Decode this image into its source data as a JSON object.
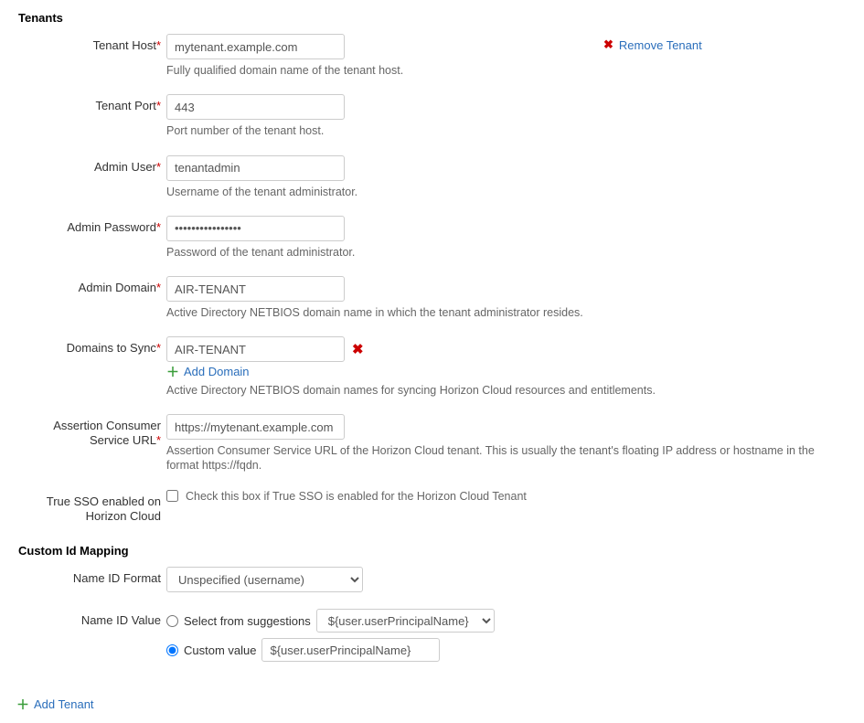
{
  "tenants": {
    "heading": "Tenants",
    "removeTenant": "Remove Tenant",
    "fields": {
      "tenantHost": {
        "label": "Tenant Host",
        "value": "mytenant.example.com",
        "helper": "Fully qualified domain name of the tenant host."
      },
      "tenantPort": {
        "label": "Tenant Port",
        "value": "443",
        "helper": "Port number of the tenant host."
      },
      "adminUser": {
        "label": "Admin User",
        "value": "tenantadmin",
        "helper": "Username of the tenant administrator."
      },
      "adminPassword": {
        "label": "Admin Password",
        "value": "••••••••••••••••",
        "helper": "Password of the tenant administrator."
      },
      "adminDomain": {
        "label": "Admin Domain",
        "value": "AIR-TENANT",
        "helper": "Active Directory NETBIOS domain name in which the tenant administrator resides."
      },
      "domainsToSync": {
        "label": "Domains to Sync",
        "value": "AIR-TENANT",
        "addDomain": "Add Domain",
        "helper": "Active Directory NETBIOS domain names for syncing Horizon Cloud resources and entitlements."
      },
      "acsUrl": {
        "label": "Assertion Consumer Service URL",
        "value": "https://mytenant.example.com",
        "helper": "Assertion Consumer Service URL of the Horizon Cloud tenant. This is usually the tenant's floating IP address or hostname in the format https://fqdn."
      },
      "trueSso": {
        "label": "True SSO enabled on Horizon Cloud",
        "helper": "Check this box if True SSO is enabled for the Horizon Cloud Tenant"
      }
    }
  },
  "customIdMapping": {
    "heading": "Custom Id Mapping",
    "nameIdFormat": {
      "label": "Name ID Format",
      "value": "Unspecified (username)"
    },
    "nameIdValue": {
      "label": "Name ID Value",
      "suggestionsLabel": "Select from suggestions",
      "suggestionsValue": "${user.userPrincipalName}",
      "customLabel": "Custom value",
      "customValue": "${user.userPrincipalName}"
    }
  },
  "addTenant": "Add Tenant",
  "requiredMark": "*"
}
